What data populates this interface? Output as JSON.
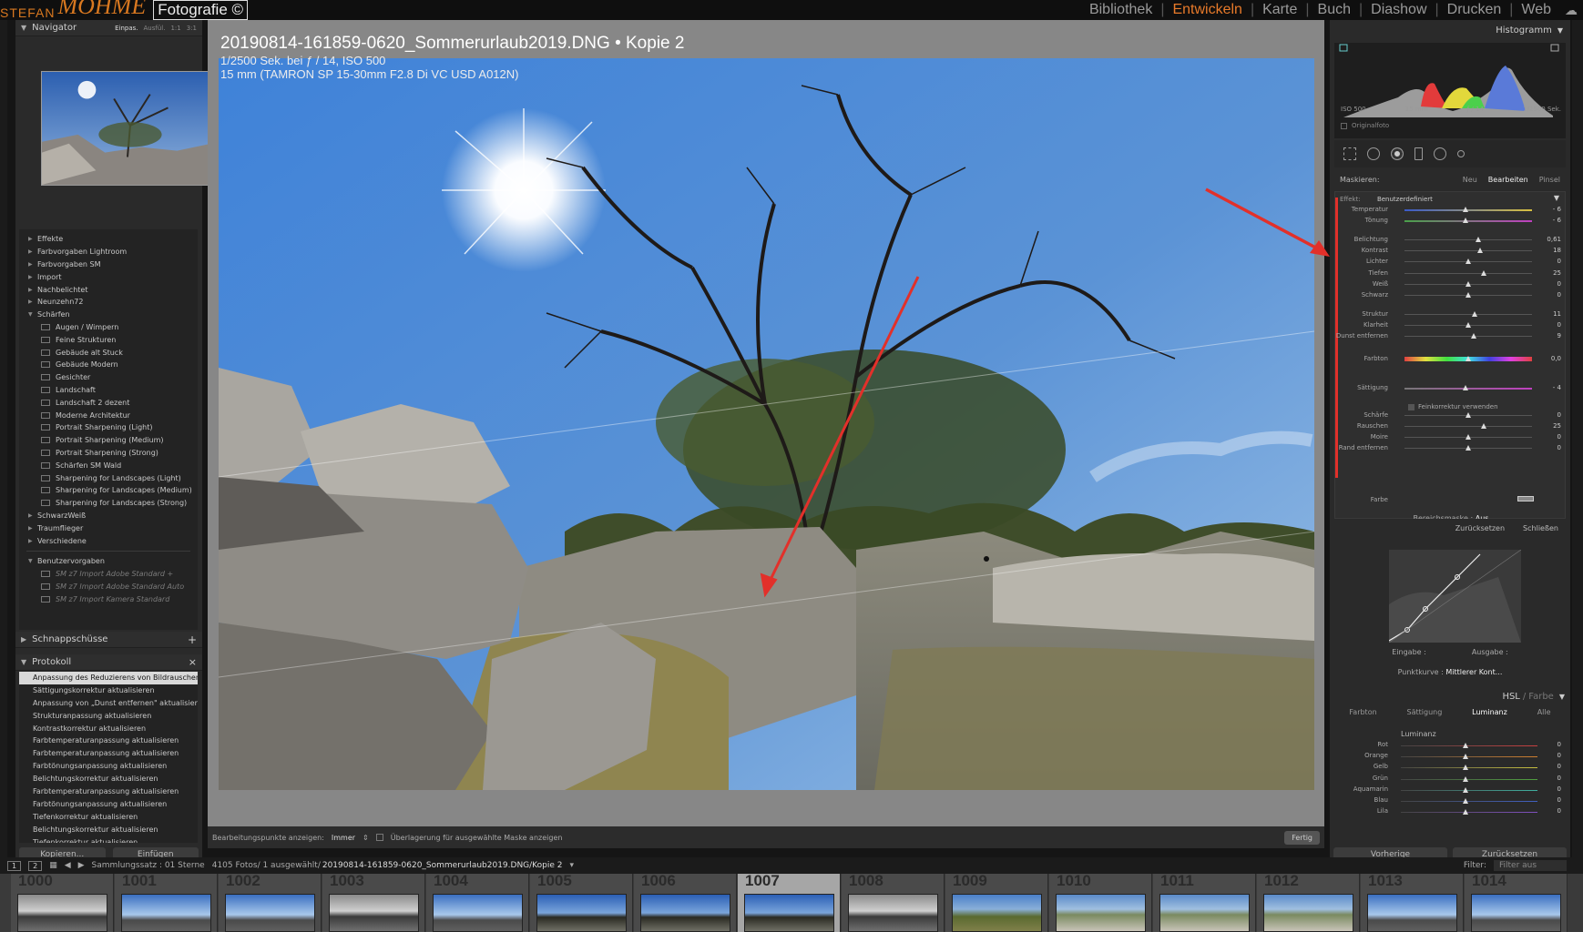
{
  "branding": {
    "part1": "STEFAN",
    "part2": "MOHME",
    "part3": "Fotografie ©"
  },
  "modules": [
    "Bibliothek",
    "Entwickeln",
    "Karte",
    "Buch",
    "Diashow",
    "Drucken",
    "Web"
  ],
  "active_module": "Entwickeln",
  "navigator": {
    "title": "Navigator",
    "options": [
      "Einpas.",
      "Ausfül.",
      "1:1",
      "3:1"
    ]
  },
  "presets": [
    {
      "label": "Effekte",
      "kind": "group"
    },
    {
      "label": "Farbvorgaben Lightroom",
      "kind": "group"
    },
    {
      "label": "Farbvorgaben SM",
      "kind": "group"
    },
    {
      "label": "Import",
      "kind": "group"
    },
    {
      "label": "Nachbelichtet",
      "kind": "group"
    },
    {
      "label": "Neunzehn72",
      "kind": "group"
    },
    {
      "label": "Schärfen",
      "kind": "open"
    },
    {
      "label": "Augen / Wimpern",
      "kind": "sub"
    },
    {
      "label": "Feine Strukturen",
      "kind": "sub"
    },
    {
      "label": "Gebäude alt Stuck",
      "kind": "sub"
    },
    {
      "label": "Gebäude Modern",
      "kind": "sub"
    },
    {
      "label": "Gesichter",
      "kind": "sub"
    },
    {
      "label": "Landschaft",
      "kind": "sub"
    },
    {
      "label": "Landschaft 2 dezent",
      "kind": "sub"
    },
    {
      "label": "Moderne Architektur",
      "kind": "sub"
    },
    {
      "label": "Portrait Sharpening (Light)",
      "kind": "sub"
    },
    {
      "label": "Portrait Sharpening (Medium)",
      "kind": "sub"
    },
    {
      "label": "Portrait Sharpening (Strong)",
      "kind": "sub"
    },
    {
      "label": "Schärfen SM Wald",
      "kind": "sub"
    },
    {
      "label": "Sharpening for Landscapes (Light)",
      "kind": "sub"
    },
    {
      "label": "Sharpening for Landscapes (Medium)",
      "kind": "sub"
    },
    {
      "label": "Sharpening for Landscapes (Strong)",
      "kind": "sub"
    },
    {
      "label": "SchwarzWeiß",
      "kind": "group"
    },
    {
      "label": "Traumflieger",
      "kind": "group"
    },
    {
      "label": "Verschiedene",
      "kind": "group"
    },
    {
      "label": "",
      "kind": "sep"
    },
    {
      "label": "Benutzervorgaben",
      "kind": "open"
    },
    {
      "label": "SM z7 Import Adobe Standard +",
      "kind": "subdim"
    },
    {
      "label": "SM z7 Import Adobe Standard Auto",
      "kind": "subdim"
    },
    {
      "label": "SM z7 Import Kamera Standard",
      "kind": "subdim"
    }
  ],
  "snapshots": {
    "title": "Schnappschüsse"
  },
  "history": {
    "title": "Protokoll",
    "items": [
      "Anpassung des Reduzierens von Bildrauschen ...",
      "Sättigungskorrektur aktualisieren",
      "Anpassung von „Dunst entfernen\" aktualisieren",
      "Strukturanpassung aktualisieren",
      "Kontrastkorrektur aktualisieren",
      "Farbtemperaturanpassung aktualisieren",
      "Farbtemperaturanpassung aktualisieren",
      "Farbtönungsanpassung aktualisieren",
      "Belichtungskorrektur aktualisieren",
      "Farbtemperaturanpassung aktualisieren",
      "Farbtönungsanpassung aktualisieren",
      "Tiefenkorrektur aktualisieren",
      "Belichtungskorrektur aktualisieren",
      "Tiefenkorrektur aktualisieren"
    ]
  },
  "left_buttons": {
    "copy": "Kopieren...",
    "paste": "Einfügen"
  },
  "photo": {
    "title": "20190814-161859-0620_Sommerurlaub2019.DNG  •  Kopie 2",
    "exif1": "1/2500 Sek. bei ƒ / 14, ISO 500",
    "exif2": "15 mm (TAMRON SP 15-30mm F2.8 Di VC USD A012N)"
  },
  "toolbar": {
    "points_label": "Bearbeitungspunkte anzeigen:",
    "points_value": "Immer",
    "overlay_label": "Überlagerung für ausgewählte Maske anzeigen",
    "done": "Fertig"
  },
  "histogram": {
    "title": "Histogramm",
    "iso": "ISO 500",
    "focal": "15 mm",
    "aperture": "ƒ / 14",
    "shutter": "1/2500 Sek.",
    "original": "Originalfoto"
  },
  "mask": {
    "title": "Maskieren:",
    "new": "Neu",
    "edit": "Bearbeiten",
    "brush": "Pinsel"
  },
  "effect": {
    "label": "Effekt:",
    "value": "Benutzerdefiniert"
  },
  "sliders": [
    {
      "label": "Temperatur",
      "value": "- 6",
      "fraction": 0.48
    },
    {
      "label": "Tönung",
      "value": "- 6",
      "fraction": 0.48
    },
    {
      "label": "Belichtung",
      "value": "0,61",
      "fraction": 0.58
    },
    {
      "label": "Kontrast",
      "value": "18",
      "fraction": 0.59
    },
    {
      "label": "Lichter",
      "value": "0",
      "fraction": 0.5
    },
    {
      "label": "Tiefen",
      "value": "25",
      "fraction": 0.62
    },
    {
      "label": "Weiß",
      "value": "0",
      "fraction": 0.5
    },
    {
      "label": "Schwarz",
      "value": "0",
      "fraction": 0.5
    },
    {
      "label": "Struktur",
      "value": "11",
      "fraction": 0.55
    },
    {
      "label": "Klarheit",
      "value": "0",
      "fraction": 0.5
    },
    {
      "label": "Dunst entfernen",
      "value": "9",
      "fraction": 0.54
    },
    {
      "label": "Farbton",
      "value": "0,0",
      "fraction": 0.5
    },
    {
      "label": "Sättigung",
      "value": "- 4",
      "fraction": 0.48
    },
    {
      "label": "Schärfe",
      "value": "0",
      "fraction": 0.5
    },
    {
      "label": "Rauschen",
      "value": "25",
      "fraction": 0.62
    },
    {
      "label": "Moire",
      "value": "0",
      "fraction": 0.5
    },
    {
      "label": "Rand entfernen",
      "value": "0",
      "fraction": 0.5
    }
  ],
  "fine_correction": "Feinkorrektur verwenden",
  "color_label": "Farbe",
  "range_mask": {
    "label": "Bereichsmaske :",
    "value": "Aus"
  },
  "adj_footer": {
    "reset": "Zurücksetzen",
    "close": "Schließen"
  },
  "curve": {
    "input": "Eingabe :",
    "output": "Ausgabe :",
    "point_label": "Punktkurve :",
    "point_value": "Mittlerer Kont..."
  },
  "hsl": {
    "title": "HSL",
    "title2": "Farbe",
    "tabs": [
      "Farbton",
      "Sättigung",
      "Luminanz",
      "Alle"
    ],
    "active_tab": "Luminanz",
    "section": "Luminanz",
    "sliders": [
      {
        "label": "Rot",
        "value": "0",
        "color": "#c84040"
      },
      {
        "label": "Orange",
        "value": "0",
        "color": "#d08030"
      },
      {
        "label": "Gelb",
        "value": "0",
        "color": "#c8c040"
      },
      {
        "label": "Grün",
        "value": "0",
        "color": "#50a040"
      },
      {
        "label": "Aquamarin",
        "value": "0",
        "color": "#40b0a0"
      },
      {
        "label": "Blau",
        "value": "0",
        "color": "#4060c0"
      },
      {
        "label": "Lila",
        "value": "0",
        "color": "#8050c0"
      }
    ]
  },
  "right_buttons": {
    "previous": "Vorherige",
    "reset": "Zurücksetzen"
  },
  "filmbar": {
    "view1": "1",
    "view2": "2",
    "collection": "Sammlungssatz : 01 Sterne",
    "count": "4105 Fotos/ 1 ausgewählt/",
    "path": "20190814-161859-0620_Sommerurlaub2019.DNG/Kopie 2",
    "filter_label": "Filter:",
    "filter_value": "Filter aus"
  },
  "filmstrip": [
    {
      "num": "1000",
      "tone": "bw"
    },
    {
      "num": "1001",
      "tone": "sky"
    },
    {
      "num": "1002",
      "tone": "sky"
    },
    {
      "num": "1003",
      "tone": "bw"
    },
    {
      "num": "1004",
      "tone": "sky"
    },
    {
      "num": "1005",
      "tone": "tree"
    },
    {
      "num": "1006",
      "tone": "tree"
    },
    {
      "num": "1007",
      "tone": "tree"
    },
    {
      "num": "1008",
      "tone": "bw"
    },
    {
      "num": "1009",
      "tone": "green"
    },
    {
      "num": "1010",
      "tone": "rocks"
    },
    {
      "num": "1011",
      "tone": "rocks"
    },
    {
      "num": "1012",
      "tone": "rocks"
    },
    {
      "num": "1013",
      "tone": "sky"
    },
    {
      "num": "1014",
      "tone": "sky"
    }
  ],
  "active_thumb": "1007",
  "colors": {
    "accent": "#e87a2a",
    "red_arrow": "#e2302a"
  }
}
